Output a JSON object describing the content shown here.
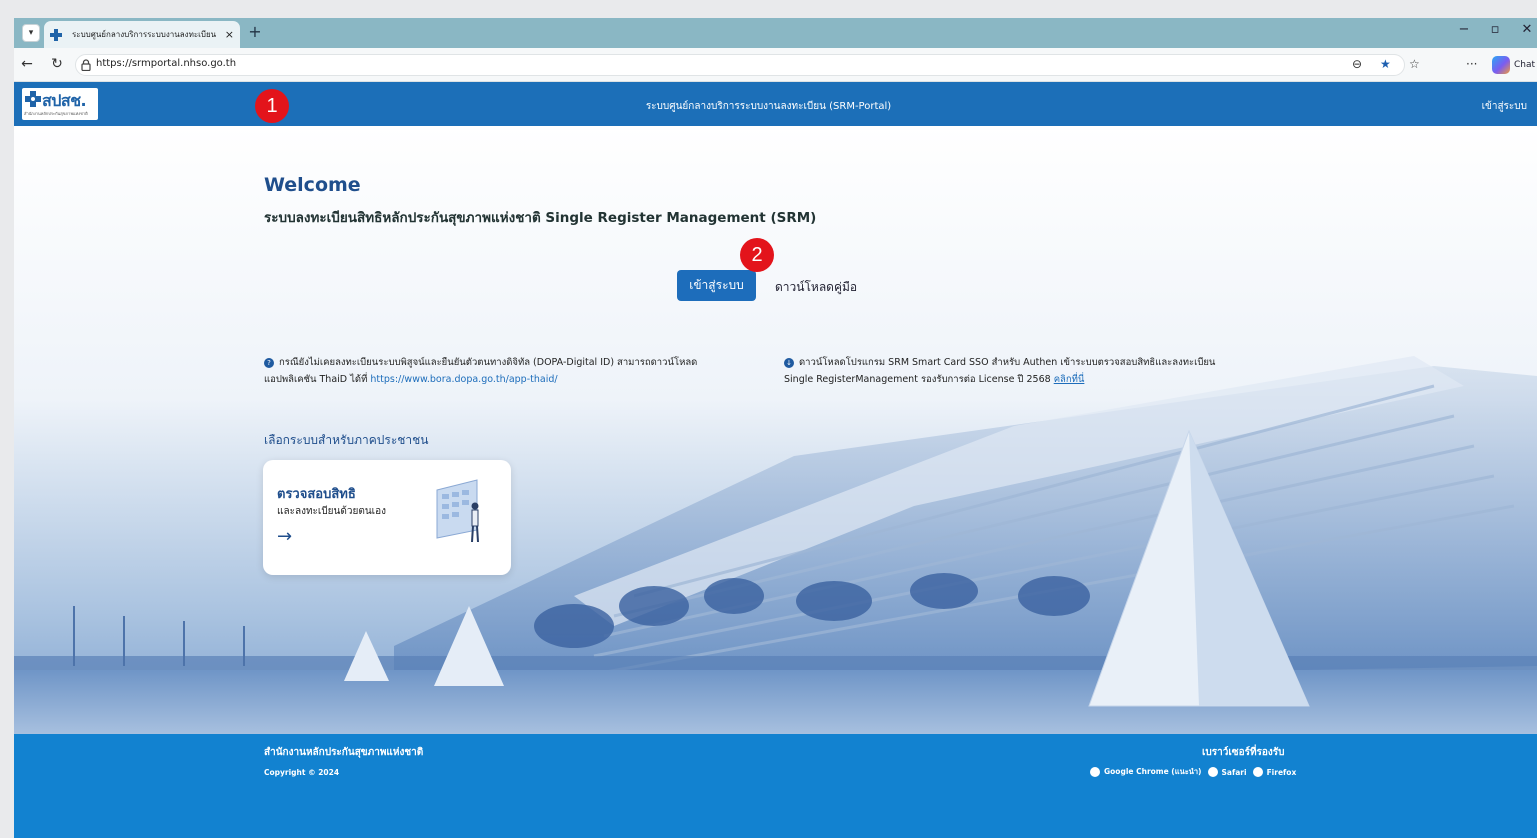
{
  "browser": {
    "tab_title": "ระบบศูนย์กลางบริการระบบงานลงทะเบียน",
    "tab_close": "×",
    "new_tab": "+",
    "url": "https://srmportal.nhso.go.th",
    "chat_label": "Chat",
    "window_controls": {
      "minimize": "−",
      "restore": "▫",
      "close": "✕"
    }
  },
  "header": {
    "logo_text": "สปสช.",
    "logo_sub": "สำนักงานหลักประกันสุขภาพแห่งชาติ",
    "title": "ระบบศูนย์กลางบริการระบบงานลงทะเบียน (SRM-Portal)",
    "login_link": "เข้าสู่ระบบ"
  },
  "main": {
    "welcome": "Welcome",
    "subtitle": "ระบบลงทะเบียนสิทธิหลักประกันสุขภาพแห่งชาติ Single Register Management (SRM)",
    "login_button": "เข้าสู่ระบบ",
    "manual_link": "ดาวน์โหลดคู่มือ",
    "info_left": {
      "text1": "กรณียังไม่เคยลงทะเบียนระบบพิสูจน์และยืนยันตัวตนทางดิจิทัล (DOPA-Digital ID) สามารถดาวน์โหลด",
      "text2": "แอปพลิเคชัน ThaiD ได้ที่",
      "link": "https://www.bora.dopa.go.th/app-thaid/"
    },
    "info_right": {
      "text1": "ดาวน์โหลดโปรแกรม SRM Smart Card SSO สำหรับ Authen เข้าระบบตรวจสอบสิทธิและลงทะเบียน",
      "text2": "Single RegisterManagement รองรับการต่อ License ปี 2568",
      "link": "คลิกที่นี่"
    },
    "section_title": "เลือกระบบสำหรับภาคประชาชน",
    "card": {
      "title": "ตรวจสอบสิทธิ",
      "desc": "และลงทะเบียนด้วยตนเอง",
      "arrow": "→"
    }
  },
  "badges": {
    "one": "1",
    "two": "2"
  },
  "footer": {
    "org": "สำนักงานหลักประกันสุขภาพแห่งชาติ",
    "copyright": "Copyright © 2024",
    "browsers_title": "เบราว์เซอร์ที่รองรับ",
    "browsers": [
      "Google Chrome (แนะนำ)",
      "Safari",
      "Firefox"
    ]
  },
  "colors": {
    "header_blue": "#1c6fb8",
    "button_blue": "#1d6dbb",
    "footer_blue": "#1282d0",
    "title_blue": "#1f4e8c",
    "badge_red": "#e3141b"
  }
}
